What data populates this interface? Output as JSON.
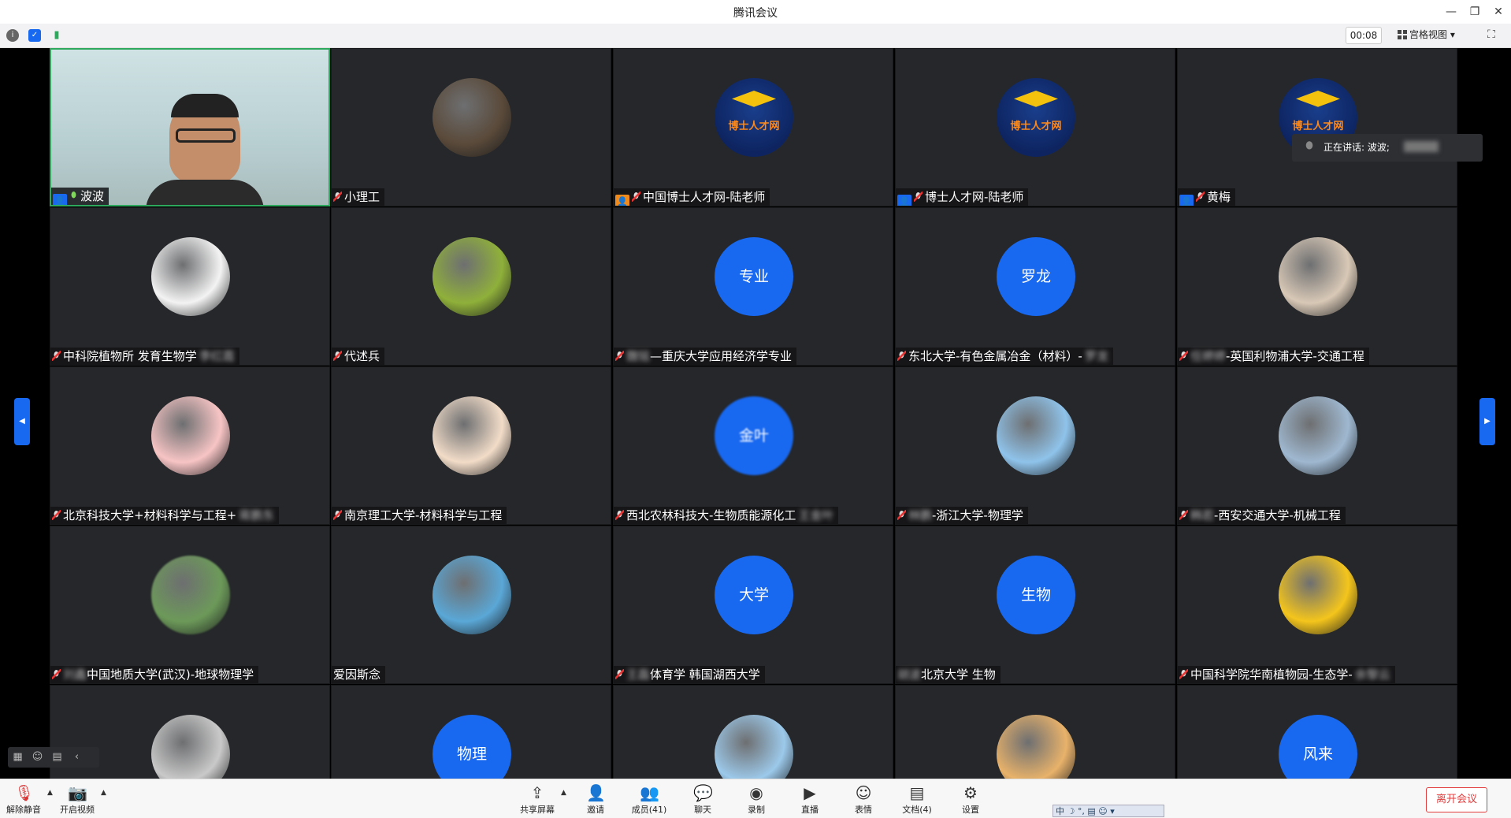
{
  "window": {
    "title": "腾讯会议",
    "minimize": "—",
    "restore": "❐",
    "close": "✕"
  },
  "statusbar": {
    "timer": "00:08",
    "view_label": "宫格视图",
    "view_caret": "▾",
    "fullscreen": "⛶",
    "info": "i",
    "shield": "✓",
    "signal": "▮"
  },
  "speaking": {
    "label": "正在讲话: 波波;"
  },
  "participants": [
    {
      "name": "波波",
      "avatar": "video",
      "badge": "user",
      "mic": "on",
      "blurred_suffix": ""
    },
    {
      "name": "小理工",
      "avatar": "photo",
      "badge": "",
      "mic": "muted",
      "blurred_suffix": "",
      "avatar_color": "#5a4a3a"
    },
    {
      "name": "中国博士人才网-陆老师",
      "avatar": "logo",
      "badge": "user-orange",
      "mic": "muted",
      "blurred_suffix": ""
    },
    {
      "name": "博士人才网-陆老师",
      "avatar": "logo",
      "badge": "user",
      "mic": "muted",
      "blurred_suffix": ""
    },
    {
      "name": "黄梅",
      "avatar": "logo",
      "badge": "user",
      "mic": "muted",
      "blurred_suffix": ""
    },
    {
      "name": "中科院植物所 发育生物学",
      "avatar": "photo",
      "badge": "",
      "mic": "muted",
      "blurred_suffix": "李红霞",
      "avatar_color": "#f3f3f3"
    },
    {
      "name": "代述兵",
      "avatar": "photo",
      "badge": "",
      "mic": "muted",
      "blurred_suffix": "",
      "avatar_color": "#8fb03a"
    },
    {
      "name": "—重庆大学应用经济学专业",
      "avatar": "text",
      "avatar_text": "专业",
      "badge": "",
      "mic": "muted",
      "blurred_prefix": "魏铭"
    },
    {
      "name": "东北大学-有色金属冶金（材料）-",
      "avatar": "text",
      "avatar_text": "罗龙",
      "badge": "",
      "mic": "muted",
      "blurred_suffix": "罗龙"
    },
    {
      "name": "-英国利物浦大学-交通工程",
      "avatar": "photo",
      "badge": "",
      "mic": "muted",
      "blurred_prefix": "任婷婷",
      "avatar_color": "#d8c8b6"
    },
    {
      "name": "北京科技大学+材料科学与工程+",
      "avatar": "photo",
      "badge": "",
      "mic": "muted",
      "blurred_suffix": "蒋鹏东",
      "avatar_color": "#f7c4c4"
    },
    {
      "name": "南京理工大学-材料科学与工程",
      "avatar": "photo",
      "badge": "",
      "mic": "muted",
      "blurred_suffix": "",
      "avatar_color": "#f2dcc8"
    },
    {
      "name": "西北农林科技大-生物质能源化工",
      "avatar": "text",
      "avatar_text": "金叶",
      "avatar_blur": true,
      "badge": "",
      "mic": "muted",
      "blurred_suffix": "王金叶"
    },
    {
      "name": "-浙江大学-物理学",
      "avatar": "photo",
      "badge": "",
      "mic": "muted",
      "blurred_prefix": "林鹏",
      "avatar_color": "#8fc3ea"
    },
    {
      "name": "-西安交通大学-机械工程",
      "avatar": "photo",
      "badge": "",
      "mic": "muted",
      "blurred_prefix": "韩若",
      "avatar_color": "#9fb8d0"
    },
    {
      "name": "中国地质大学(武汉)-地球物理学",
      "avatar": "photo",
      "avatar_blur": true,
      "badge": "",
      "mic": "muted",
      "blurred_prefix": "刘鑫",
      "avatar_color": "#6d9a5a"
    },
    {
      "name": "爱因斯念",
      "avatar": "photo",
      "badge": "",
      "mic": "none",
      "blurred_suffix": "",
      "avatar_color": "#5aa7d6"
    },
    {
      "name": "体育学 韩国湖西大学",
      "avatar": "text",
      "avatar_text": "大学",
      "badge": "",
      "mic": "muted",
      "blurred_prefix": "王磊"
    },
    {
      "name": "北京大学 生物",
      "avatar": "text",
      "avatar_text": "生物",
      "badge": "",
      "mic": "none",
      "blurred_prefix": "胡波"
    },
    {
      "name": "中国科学院华南植物园-生态学-",
      "avatar": "photo",
      "badge": "",
      "mic": "muted",
      "blurred_suffix": "余黎云",
      "avatar_color": "#f4c51c"
    },
    {
      "name": "",
      "avatar": "photo",
      "badge": "",
      "mic": "none",
      "avatar_color": "#c9c9c9"
    },
    {
      "name": "",
      "avatar": "text",
      "avatar_text": "物理",
      "badge": "",
      "mic": "none"
    },
    {
      "name": "",
      "avatar": "photo",
      "badge": "",
      "mic": "none",
      "avatar_color": "#9cc9ea"
    },
    {
      "name": "",
      "avatar": "photo",
      "badge": "",
      "mic": "none",
      "avatar_color": "#e8b26a"
    },
    {
      "name": "",
      "avatar": "text",
      "avatar_text": "风来",
      "badge": "",
      "mic": "none"
    }
  ],
  "logo_text": "博士人才网",
  "float_tools": {
    "layout": "▦",
    "emoji": "☺",
    "chat": "▤",
    "collapse": "‹"
  },
  "toolbar": {
    "unmute": "解除静音",
    "video": "开启视频",
    "share": "共享屏幕",
    "invite": "邀请",
    "members": "成员(41)",
    "chat": "聊天",
    "record": "录制",
    "live": "直播",
    "reactions": "表情",
    "docs": "文档(4)",
    "settings": "设置",
    "leave": "离开会议",
    "ime": "中 ☽ °, ▤ ☺ ▾"
  }
}
